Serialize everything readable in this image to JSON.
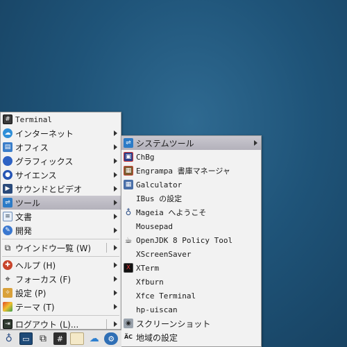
{
  "main_menu": {
    "items": [
      {
        "label": "Terminal",
        "icon": "terminal-icon",
        "mono": true,
        "submenu": false
      },
      {
        "label": "インターネット",
        "icon": "internet-icon",
        "submenu": true
      },
      {
        "label": "オフィス",
        "icon": "office-icon",
        "submenu": true
      },
      {
        "label": "グラフィックス",
        "icon": "graphics-icon",
        "submenu": true
      },
      {
        "label": "サイエンス",
        "icon": "science-icon",
        "submenu": true
      },
      {
        "label": "サウンドとビデオ",
        "icon": "multimedia-icon",
        "submenu": true
      },
      {
        "label": "ツール",
        "icon": "tools-icon",
        "submenu": true,
        "active": true
      },
      {
        "label": "文書",
        "icon": "documents-icon",
        "submenu": true
      },
      {
        "label": "開発",
        "icon": "development-icon",
        "submenu": true
      },
      {
        "label": "ウインドウ一覧 (W)",
        "icon": "window-list-icon",
        "submenu": true
      },
      {
        "label": "ヘルプ (H)",
        "icon": "help-icon",
        "submenu": true
      },
      {
        "label": "フォーカス (F)",
        "icon": "focus-icon",
        "submenu": true
      },
      {
        "label": "設定 (P)",
        "icon": "settings-icon",
        "submenu": true
      },
      {
        "label": "テーマ (T)",
        "icon": "theme-icon",
        "submenu": true
      },
      {
        "label": "ログアウト (L)...",
        "icon": "logout-icon",
        "submenu": true
      }
    ]
  },
  "tools_submenu": {
    "items": [
      {
        "label": "システムツール",
        "icon": "system-tools-icon",
        "submenu": true,
        "active": true
      },
      {
        "label": "ChBg",
        "icon": "chbg-icon",
        "mono": true
      },
      {
        "label": "Engrampa 書庫マネージャ",
        "icon": "archive-icon",
        "mono": true
      },
      {
        "label": "Galculator",
        "icon": "calculator-icon",
        "mono": true
      },
      {
        "label": "IBus の設定",
        "icon": "",
        "mono": true
      },
      {
        "label": "Mageia へようこそ",
        "icon": "mageia-icon",
        "mono": true
      },
      {
        "label": "Mousepad",
        "icon": "",
        "mono": true
      },
      {
        "label": "OpenJDK 8 Policy Tool",
        "icon": "java-icon",
        "mono": true
      },
      {
        "label": "XScreenSaver",
        "icon": "",
        "mono": true
      },
      {
        "label": "XTerm",
        "icon": "xterm-icon",
        "mono": true
      },
      {
        "label": "Xfburn",
        "icon": "",
        "mono": true
      },
      {
        "label": "Xfce Terminal",
        "icon": "",
        "mono": true
      },
      {
        "label": "hp-uiscan",
        "icon": "",
        "mono": true
      },
      {
        "label": "スクリーンショット",
        "icon": "screenshot-icon"
      },
      {
        "label": "地域の設定",
        "icon": "locale-icon"
      }
    ]
  },
  "panel": {
    "buttons": [
      {
        "name": "menu-button",
        "icon": "mageia-logo-icon"
      },
      {
        "name": "desktop-button",
        "icon": "show-desktop-icon"
      },
      {
        "name": "windows-button",
        "icon": "window-switcher-icon"
      },
      {
        "name": "terminal-launcher",
        "icon": "terminal-icon",
        "glyph": "#"
      },
      {
        "name": "files-launcher",
        "icon": "file-manager-icon"
      },
      {
        "name": "browser-launcher",
        "icon": "browser-icon"
      },
      {
        "name": "settings-launcher",
        "icon": "control-center-icon"
      }
    ]
  }
}
